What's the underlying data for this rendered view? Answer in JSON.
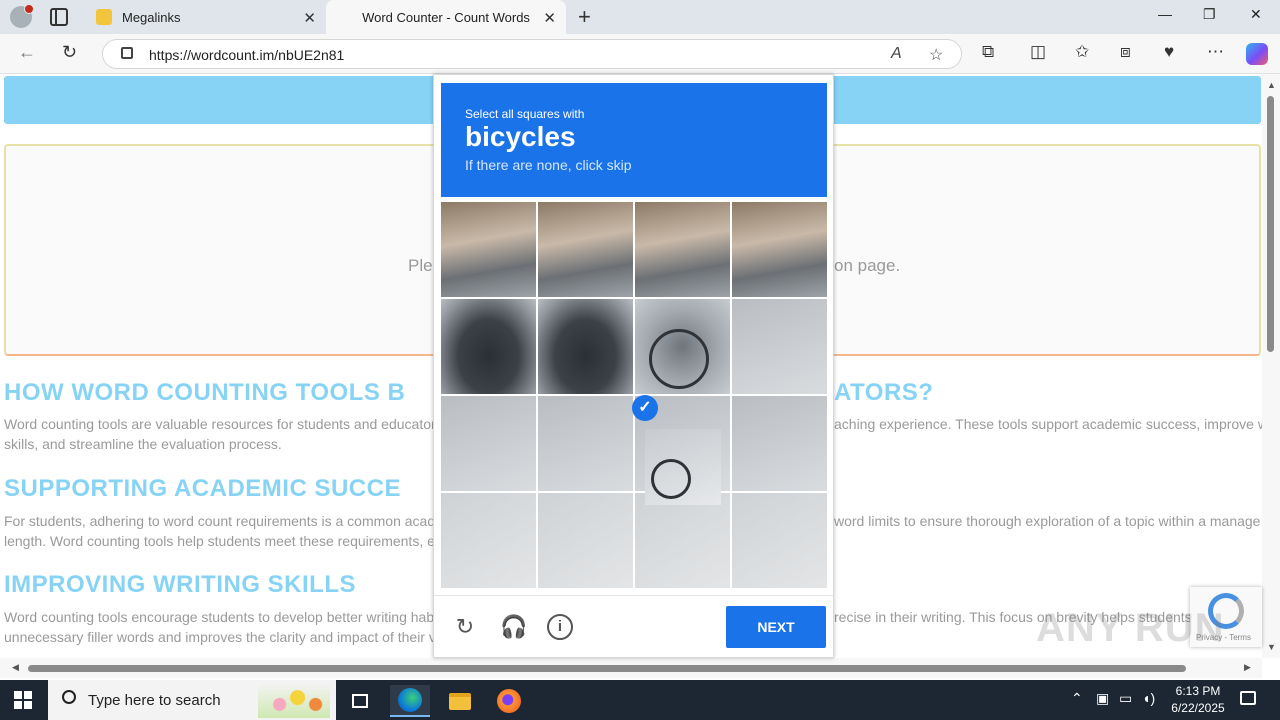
{
  "browser": {
    "tabs": [
      {
        "title": "Megalinks",
        "active": false
      },
      {
        "title": "Word Counter - Count Words",
        "active": true
      }
    ],
    "new_tab_icon": "+",
    "window_controls": {
      "minimize": "—",
      "restore": "❐",
      "close": "✕"
    },
    "url": "https://wordcount.im/nbUE2n81",
    "icons": {
      "back": "←",
      "refresh": "↻",
      "read_aloud": "A",
      "favorite": "☆",
      "extensions": "⧉",
      "split": "◫",
      "favorites_bar": "✩",
      "collections": "⧈",
      "performance": "♥",
      "more": "⋯"
    }
  },
  "page": {
    "hint_left": "Ple",
    "hint_right": "on page.",
    "sections": [
      {
        "heading_left": "HOW WORD COUNTING TOOLS B",
        "heading_right": "ATORS?",
        "para_left": [
          "Word counting tools are valuable resources for students and educator",
          "skills, and streamline the evaluation process."
        ],
        "para_right": [
          "aching experience. These tools support academic success, improve w",
          ""
        ]
      },
      {
        "heading_left": "SUPPORTING ACADEMIC SUCCE",
        "heading_right": "",
        "para_left": [
          "For students, adhering to word count requirements is a common acad",
          "length. Word counting tools help students meet these requirements, e"
        ],
        "para_right": [
          "word limits to ensure thorough exploration of a topic within a manage",
          ""
        ]
      },
      {
        "heading_left": "IMPROVING WRITING SKILLS",
        "heading_right": "",
        "para_left": [
          "Word counting tools encourage students to develop better writing hab",
          "unnecessary filler words and improves the clarity and impact of their v"
        ],
        "para_right": [
          "recise in their writing. This focus on brevity helps students",
          ""
        ]
      }
    ]
  },
  "captcha": {
    "line1": "Select all squares with",
    "target": "bicycles",
    "line3": "If there are none, click skip",
    "grid_size": 4,
    "selected_tiles": [
      10
    ],
    "next_label": "NEXT",
    "icons": {
      "reload": "reload-icon",
      "audio": "headphones-icon",
      "info": "info-icon"
    }
  },
  "recaptcha_badge": {
    "terms": "Privacy - Terms"
  },
  "watermark": "ANY RUN",
  "taskbar": {
    "search_placeholder": "Type here to search",
    "time": "6:13 PM",
    "date": "6/22/2025"
  }
}
